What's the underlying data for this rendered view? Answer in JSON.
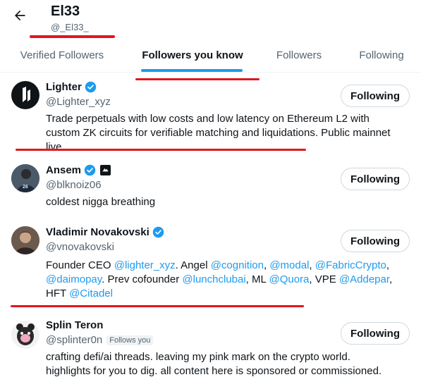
{
  "header": {
    "title": "El33",
    "handle": "@_El33_"
  },
  "tabs": [
    {
      "label": "Verified Followers",
      "active": false
    },
    {
      "label": "Followers you know",
      "active": true
    },
    {
      "label": "Followers",
      "active": false
    },
    {
      "label": "Following",
      "active": false
    }
  ],
  "colors": {
    "accent": "#1d9bf0",
    "annotation_marks": "#e0161f"
  },
  "users": [
    {
      "name": "Lighter",
      "handle": "@Lighter_xyz",
      "verified": true,
      "button_label": "Following",
      "bio_lines": [
        "Trade perpetuals with low costs and low latency on Ethereum L2 with",
        "custom ZK circuits for verifiable matching and liquidations. Public mainnet",
        "live."
      ]
    },
    {
      "name": "Ansem",
      "handle": "@blknoiz06",
      "verified": true,
      "affiliate_badge": true,
      "button_label": "Following",
      "bio": "coldest nigga breathing"
    },
    {
      "name": "Vladimir Novakovski",
      "handle": "@vnovakovski",
      "verified": true,
      "button_label": "Following",
      "bio_parts": {
        "p1": "Founder CEO ",
        "m1": "@lighter_xyz",
        "p2": ". Angel ",
        "m2": "@cognition",
        "p3": ", ",
        "m3": "@modal",
        "p4": ", ",
        "m4": "@FabricCrypto",
        "p5": ",",
        "m5": "@daimopay",
        "p6": ". Prev cofounder ",
        "m6": "@lunchclubai",
        "p7": ", ML ",
        "m7": "@Quora",
        "p8": ", VPE ",
        "m8": "@Addepar",
        "p9": ",",
        "p10": "HFT ",
        "m9": "@Citadel"
      }
    },
    {
      "name": "Splin Teron",
      "handle": "@splinter0n",
      "follows_you": "Follows you",
      "verified": false,
      "button_label": "Following",
      "bio_lines": [
        "crafting defi/ai threads. leaving my pink mark on the crypto world.",
        "highlights for you to dig. all content here is sponsored or commissioned."
      ]
    }
  ]
}
